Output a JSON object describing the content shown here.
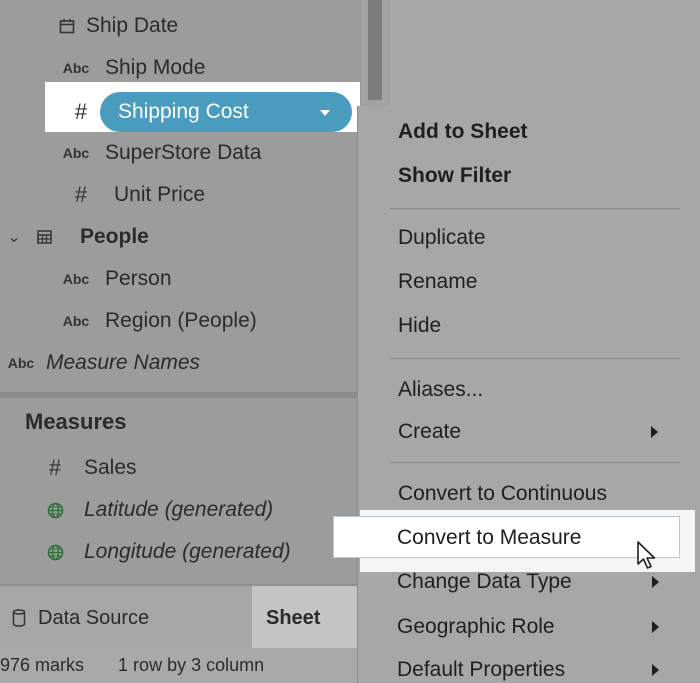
{
  "data_pane": {
    "dimension_fields": [
      {
        "label": "Ship Date",
        "icon": "calendar-icon"
      },
      {
        "label": "Ship Mode",
        "icon": "abc-icon"
      },
      {
        "label": "Shipping Cost",
        "icon": "hash-icon"
      },
      {
        "label": "SuperStore Data",
        "icon": "abc-icon"
      },
      {
        "label": "Unit Price",
        "icon": "hash-icon"
      }
    ],
    "people_folder": {
      "label": "People",
      "children": [
        "Person",
        "Region (People)"
      ]
    },
    "measure_names": "Measure Names",
    "measures_header": "Measures",
    "measure_fields": [
      "Sales",
      "Latitude (generated)",
      "Longitude (generated)"
    ],
    "abc_glyph": "Abc",
    "hash_glyph": "#"
  },
  "tabs": {
    "data_source": "Data Source",
    "sheet": "Sheet"
  },
  "status": {
    "marks": "976 marks",
    "rows": "1 row by 3 column"
  },
  "context_menu": {
    "items": [
      {
        "label": "Add to Sheet",
        "bold": true
      },
      {
        "label": "Show Filter",
        "bold": true
      },
      {
        "label": "Duplicate"
      },
      {
        "label": "Rename"
      },
      {
        "label": "Hide"
      },
      {
        "label": "Aliases..."
      },
      {
        "label": "Create",
        "submenu": true
      },
      {
        "label": "Convert to Continuous"
      },
      {
        "label": "Convert to Measure",
        "highlighted": true
      },
      {
        "label": "Change Data Type",
        "submenu": true
      },
      {
        "label": "Geographic Role",
        "submenu": true
      },
      {
        "label": "Default Properties",
        "submenu": true
      }
    ]
  },
  "colors": {
    "pill": "#4a9cbf",
    "pane": "#9c9c9c",
    "menu": "#a7a7a7"
  }
}
